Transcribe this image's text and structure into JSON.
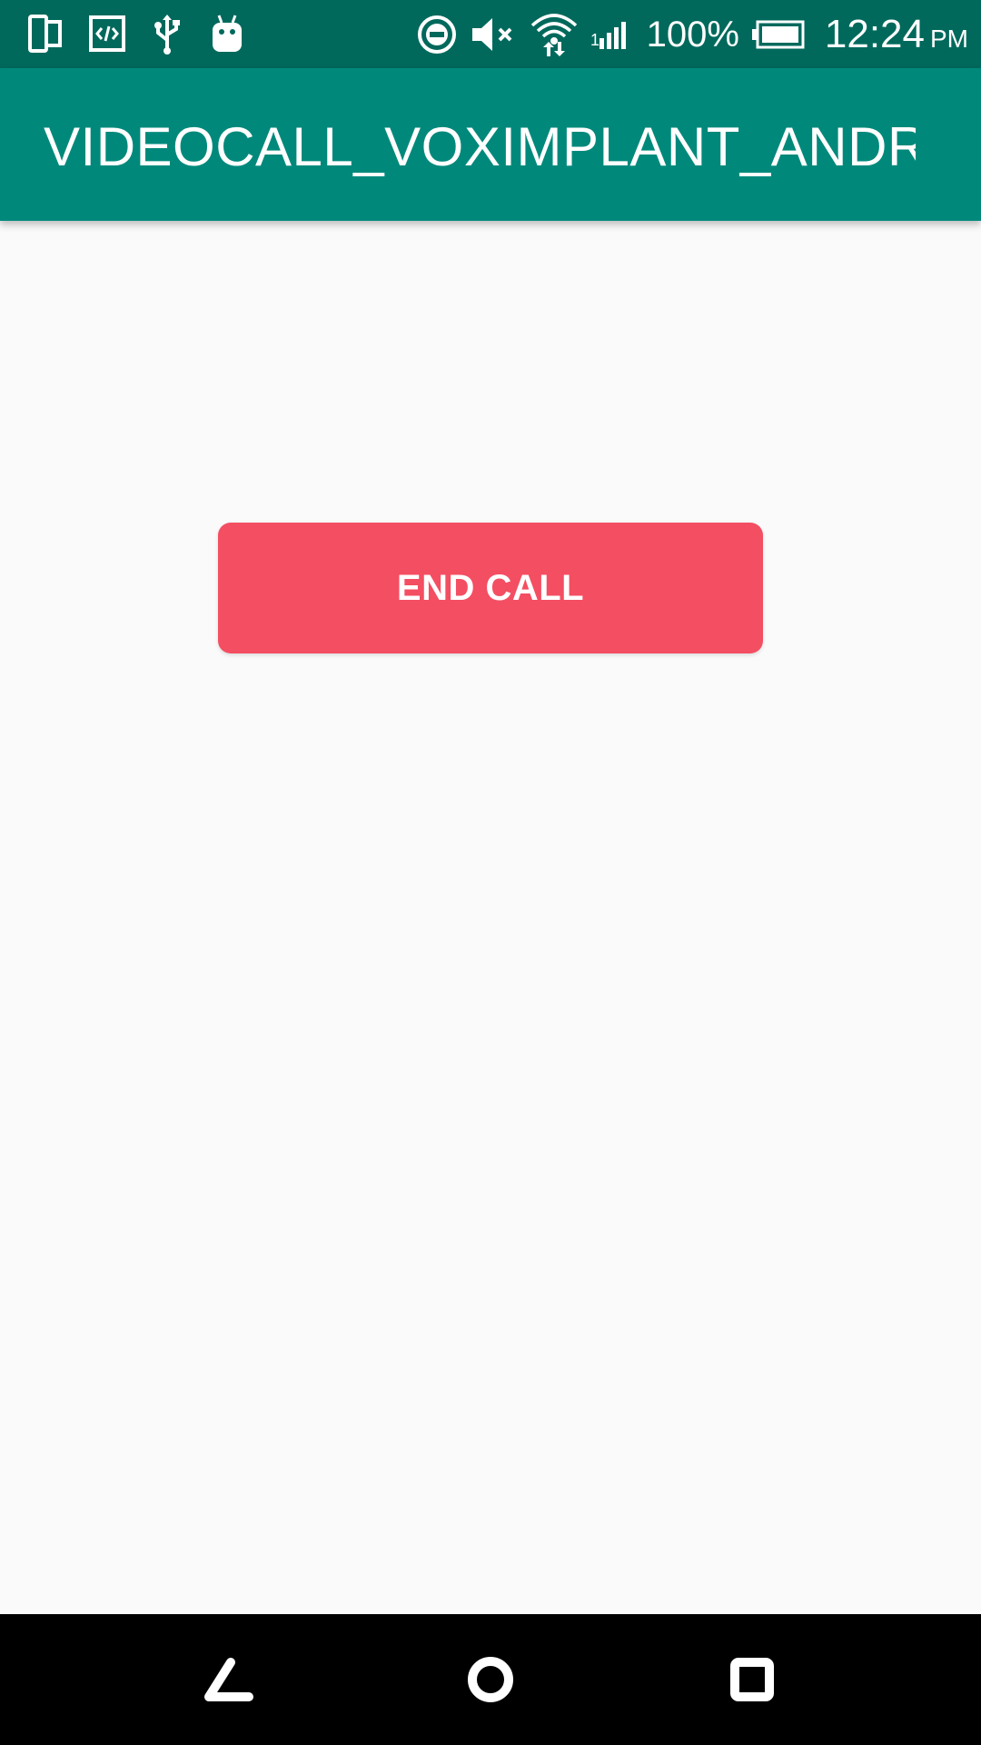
{
  "status_bar": {
    "left_icons": [
      "phone-tablet-icon",
      "code-icon",
      "usb-icon",
      "android-icon"
    ],
    "right_icons": [
      "do-not-disturb-icon",
      "volume-muted-icon",
      "wifi-icon",
      "cell-signal-icon",
      "battery-icon"
    ],
    "battery_percent": "100%",
    "time": "12:24",
    "ampm": "PM",
    "background_color": "#00695c"
  },
  "app_bar": {
    "title": "VIDEOCALL_VOXIMPLANT_ANDR…",
    "background_color": "#00897b"
  },
  "main": {
    "end_call_label": "END CALL",
    "end_call_color": "#f44e62",
    "background_color": "#fafafa"
  },
  "nav_bar": {
    "buttons": [
      "back-icon",
      "home-icon",
      "recents-icon"
    ]
  }
}
